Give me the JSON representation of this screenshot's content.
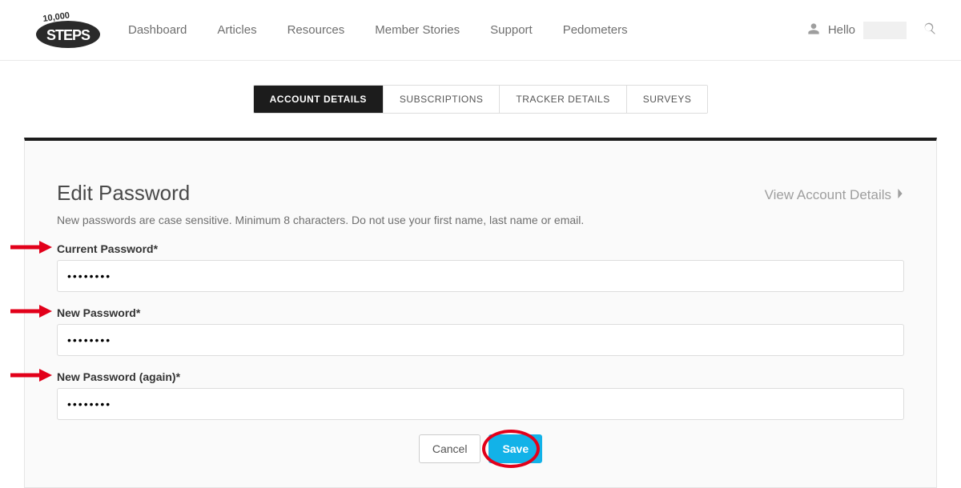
{
  "header": {
    "nav": [
      "Dashboard",
      "Articles",
      "Resources",
      "Member Stories",
      "Support",
      "Pedometers"
    ],
    "greeting": "Hello"
  },
  "tabs": {
    "items": [
      "ACCOUNT DETAILS",
      "SUBSCRIPTIONS",
      "TRACKER DETAILS",
      "SURVEYS"
    ],
    "active": 0
  },
  "panel": {
    "title": "Edit Password",
    "subtitle": "New passwords are case sensitive. Minimum 8 characters. Do not use your first name, last name or email.",
    "view_link": "View Account Details",
    "fields": {
      "current": {
        "label": "Current Password*",
        "value": "••••••••"
      },
      "new": {
        "label": "New Password*",
        "value": "••••••••"
      },
      "again": {
        "label": "New Password (again)*",
        "value": "••••••••"
      }
    },
    "buttons": {
      "cancel": "Cancel",
      "save": "Save"
    }
  }
}
